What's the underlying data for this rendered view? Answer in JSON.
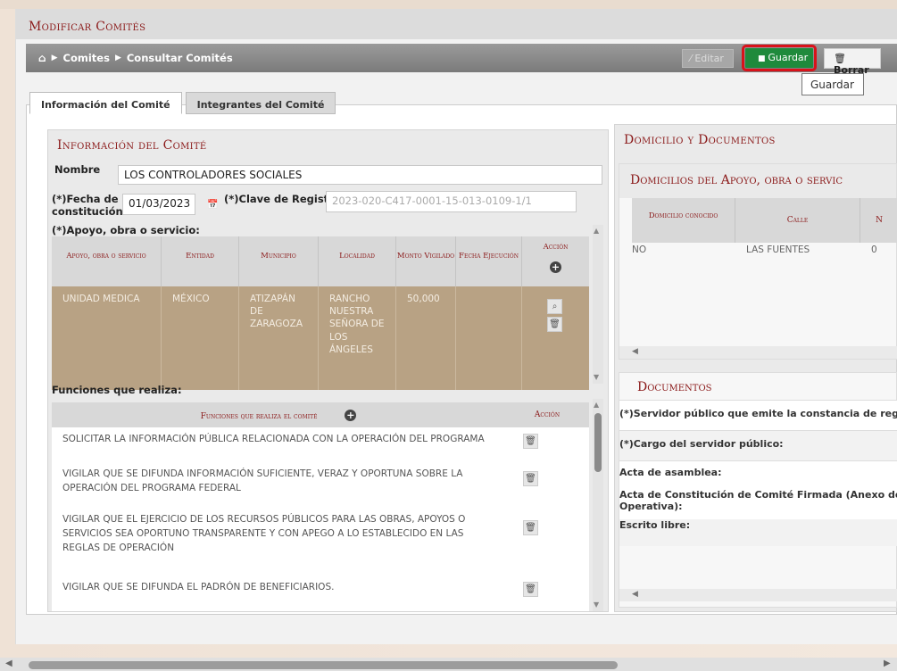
{
  "window": {
    "title": "Modificar Comités"
  },
  "breadcrumb": {
    "home": "⌂",
    "items": [
      "Comites",
      "Consultar Comités"
    ]
  },
  "toolbar": {
    "editar": "Editar",
    "guardar": "Guardar",
    "borrar": "Borrar",
    "tooltip": "Guardar"
  },
  "tabs": [
    "Información del Comité",
    "Integrantes del Comité"
  ],
  "info": {
    "heading": "Información del Comité",
    "nombre_label": "Nombre",
    "nombre_value": "LOS CONTROLADORES SOCIALES",
    "fecha_label_1": "(*)Fecha de",
    "fecha_label_2": "constitución:",
    "fecha_value": "01/03/2023",
    "clave_label": "(*)Clave de Registro:",
    "clave_value": "2023-020-C417-0001-15-013-0109-1/1",
    "apoyo_label": "(*)Apoyo, obra o servicio:",
    "apoyo_headers": [
      "Apoyo, obra o servicio",
      "Entidad",
      "Municipio",
      "Localidad",
      "Monto Vigilado",
      "Fecha Ejecución",
      "Acción"
    ],
    "apoyo_row": [
      "UNIDAD MEDICA",
      "MÉXICO",
      "ATIZAPÁN DE ZARAGOZA",
      "RANCHO NUESTRA SEÑORA DE LOS ÁNGELES",
      "50,000",
      ""
    ],
    "funciones_label": "Funciones que realiza:",
    "funciones_header": "Funciones que realiza el comité",
    "funciones_accion": "Acción",
    "funciones": [
      "SOLICITAR LA INFORMACIÓN PÚBLICA RELACIONADA CON LA OPERACIÓN DEL PROGRAMA",
      "VIGILAR QUE SE DIFUNDA INFORMACIÓN SUFICIENTE, VERAZ Y OPORTUNA SOBRE LA OPERACIÓN DEL PROGRAMA FEDERAL",
      "VIGILAR QUE EL EJERCICIO DE LOS RECURSOS PÚBLICOS PARA LAS OBRAS, APOYOS O SERVICIOS SEA OPORTUNO TRANSPARENTE Y CON APEGO A LO ESTABLECIDO EN LAS REGLAS DE OPERACIÓN",
      "VIGILAR QUE SE DIFUNDA EL PADRÓN DE BENEFICIARIOS."
    ]
  },
  "domicilio": {
    "heading": "Domicilio y Documentos",
    "sub_heading": "Domicilios del Apoyo, obra o servic",
    "headers": [
      "Domicilio conocido",
      "Calle",
      "N"
    ],
    "row": [
      "NO",
      "LAS FUENTES",
      "0"
    ]
  },
  "documentos": {
    "heading": "Documentos",
    "items": [
      "(*)Servidor público que emite la constancia de regist",
      "(*)Cargo del servidor público:",
      "Acta de asamblea:",
      "Acta de Constitución de Comité Firmada (Anexo de C",
      "Operativa):",
      "Escrito libre:"
    ]
  }
}
